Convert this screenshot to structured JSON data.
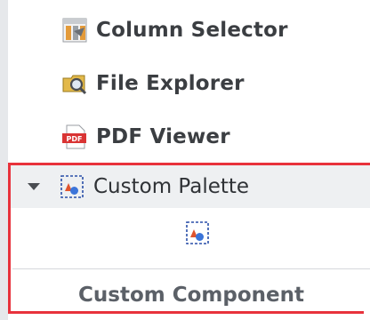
{
  "palette": {
    "items": [
      {
        "label": "Column Selector",
        "icon": "column-selector-icon"
      },
      {
        "label": "File Explorer",
        "icon": "file-explorer-icon"
      },
      {
        "label": "PDF Viewer",
        "icon": "pdf-viewer-icon",
        "icon_text": "PDF"
      }
    ],
    "group": {
      "label": "Custom Palette",
      "icon": "custom-palette-icon",
      "expanded": true
    },
    "component": {
      "label": "Custom Component",
      "icon": "custom-component-icon"
    }
  },
  "colors": {
    "highlight": "#e8323c",
    "text": "#3b3e42",
    "muted": "#5b6067",
    "group_bg": "#eef0f2"
  }
}
